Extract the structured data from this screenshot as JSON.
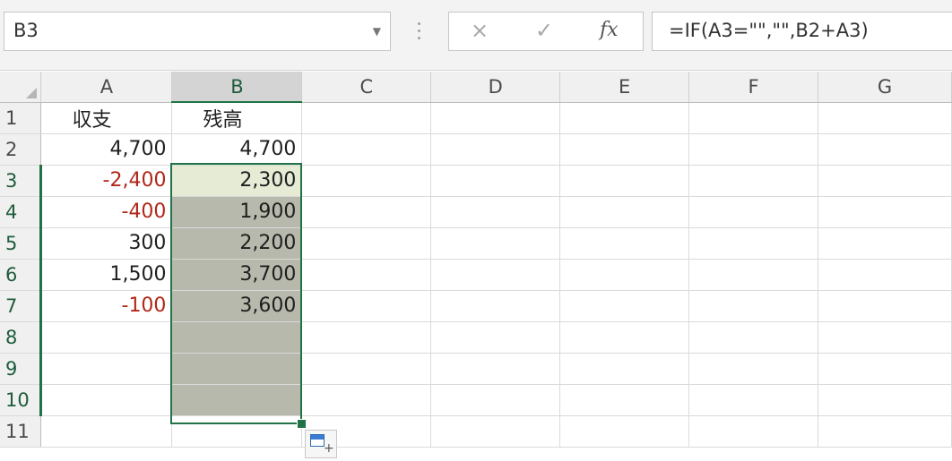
{
  "formula_bar": {
    "name_box": "B3",
    "cancel_icon": "×",
    "enter_icon": "✓",
    "fx_label": "fx",
    "formula": "=IF(A3=\"\",\"\",B2+A3)"
  },
  "columns": [
    "A",
    "B",
    "C",
    "D",
    "E",
    "F",
    "G"
  ],
  "rows": [
    {
      "num": "1",
      "a": "収支",
      "b": "残高"
    },
    {
      "num": "2",
      "a": "4,700",
      "b": "4,700"
    },
    {
      "num": "3",
      "a": "-2,400",
      "b": "2,300"
    },
    {
      "num": "4",
      "a": "-400",
      "b": "1,900"
    },
    {
      "num": "5",
      "a": "300",
      "b": "2,200"
    },
    {
      "num": "6",
      "a": "1,500",
      "b": "3,700"
    },
    {
      "num": "7",
      "a": "-100",
      "b": "3,600"
    },
    {
      "num": "8",
      "a": "",
      "b": ""
    },
    {
      "num": "9",
      "a": "",
      "b": ""
    },
    {
      "num": "10",
      "a": "",
      "b": ""
    },
    {
      "num": "11",
      "a": "",
      "b": ""
    }
  ],
  "colors": {
    "accent": "#217346",
    "negative": "#b0281a",
    "selection": "#b6b9ab"
  }
}
